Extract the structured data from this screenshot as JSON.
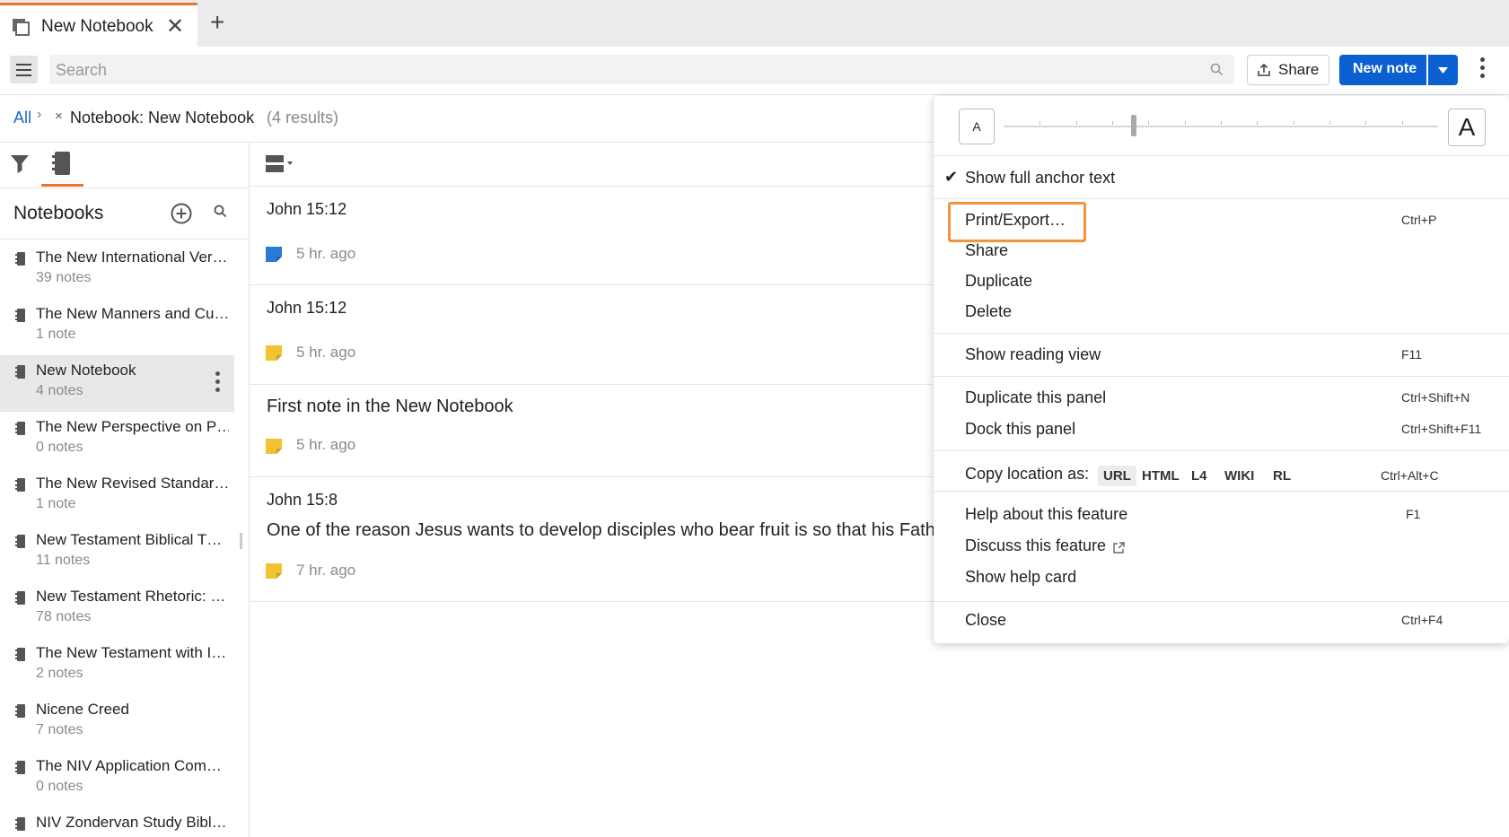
{
  "tab": {
    "title": "New Notebook",
    "close": "✕",
    "add": "+"
  },
  "toolbar": {
    "search_placeholder": "Search",
    "share_label": "Share",
    "new_note_label": "New note"
  },
  "breadcrumb": {
    "all": "All",
    "sep": "›",
    "remove": "×",
    "text": "Notebook: New Notebook",
    "count": "(4 results)"
  },
  "sidebar": {
    "title": "Notebooks",
    "notebooks": [
      {
        "name": "The New International Ver…",
        "count": "39 notes"
      },
      {
        "name": "The New Manners and Cu…",
        "count": "1 note"
      },
      {
        "name": "New Notebook",
        "count": "4 notes",
        "selected": true
      },
      {
        "name": "The New Perspective on P…",
        "count": "0 notes"
      },
      {
        "name": "The New Revised Standar…",
        "count": "1 note"
      },
      {
        "name": "New Testament Biblical T…",
        "count": "11 notes"
      },
      {
        "name": "New Testament Rhetoric: …",
        "count": "78 notes"
      },
      {
        "name": "The New Testament with I…",
        "count": "2 notes"
      },
      {
        "name": "Nicene Creed",
        "count": "7 notes"
      },
      {
        "name": "The NIV Application Com…",
        "count": "0 notes"
      },
      {
        "name": "NIV Zondervan Study Bibl…",
        "count": ""
      }
    ]
  },
  "notes": [
    {
      "title": "John 15:12",
      "body": "",
      "time": "5 hr. ago",
      "flag_color": "#2a7ad6"
    },
    {
      "title": "John 15:12",
      "body": "",
      "time": "5 hr. ago",
      "flag_color": "#f3c233"
    },
    {
      "title": "",
      "body": "First note in the New Notebook",
      "time": "5 hr. ago",
      "flag_color": "#f3c233"
    },
    {
      "title": "John 15:8",
      "body": "One of the reason Jesus wants to develop disciples who bear fruit is so that his Fath",
      "time": "7 hr. ago",
      "flag_color": "#f3c233"
    }
  ],
  "menu": {
    "font_small": "A",
    "font_large": "A",
    "font_size_level": 0.3,
    "show_anchor": "Show full anchor text",
    "print_export": "Print/Export…",
    "print_export_key": "Ctrl+P",
    "share": "Share",
    "duplicate": "Duplicate",
    "delete": "Delete",
    "reading_view": "Show reading view",
    "reading_view_key": "F11",
    "duplicate_panel": "Duplicate this panel",
    "duplicate_panel_key": "Ctrl+Shift+N",
    "dock_panel": "Dock this panel",
    "dock_panel_key": "Ctrl+Shift+F11",
    "copy_location": "Copy location as:",
    "copy_options": [
      "URL",
      "HTML",
      "L4",
      "WIKI",
      "RL"
    ],
    "copy_location_key": "Ctrl+Alt+C",
    "help_feature": "Help about this feature",
    "help_feature_key": "F1",
    "discuss_feature": "Discuss this feature",
    "help_card": "Show help card",
    "close": "Close",
    "close_key": "Ctrl+F4"
  },
  "colors": {
    "accent": "#e8762c",
    "primary": "#0a5fd1",
    "highlight": "#f4923d"
  }
}
